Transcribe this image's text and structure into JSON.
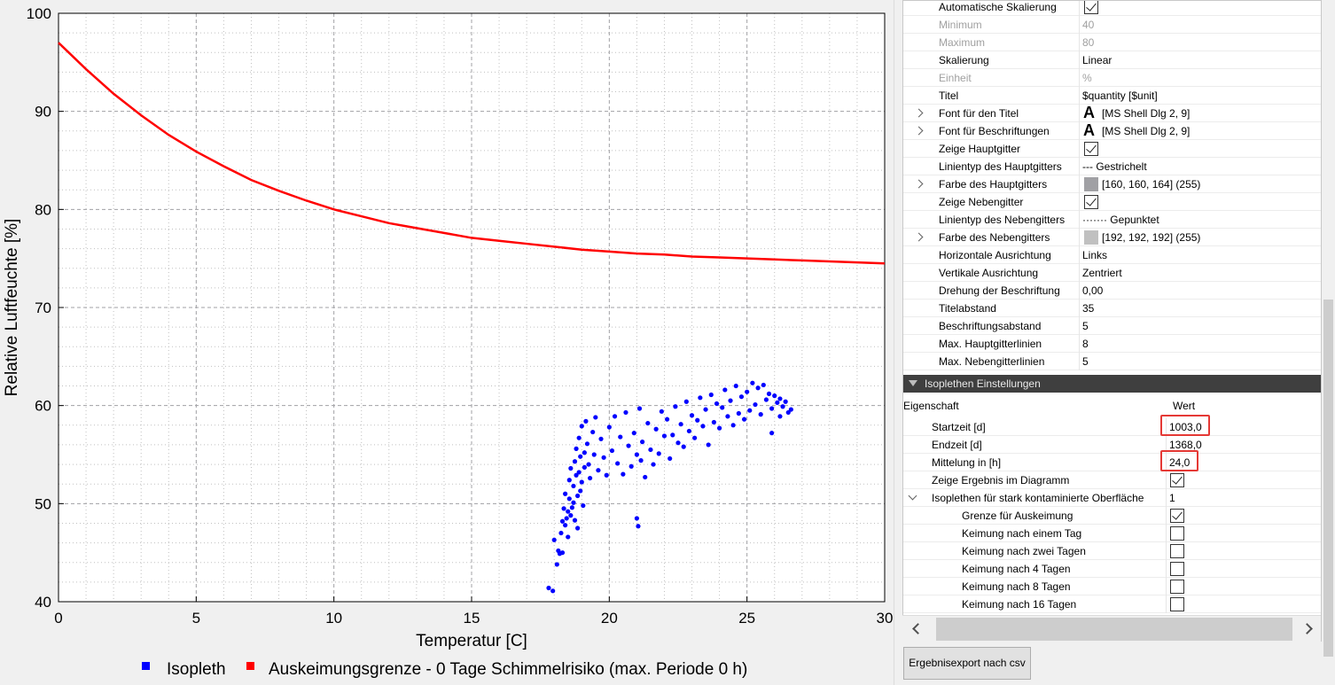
{
  "chart": {
    "xlabel": "Temperatur [C]",
    "ylabel": "Relative Luftfeuchte [%]",
    "legend": {
      "isopleth_label": "Isopleth",
      "limit_label": "Auskeimungsgrenze - 0 Tage Schimmelrisiko (max. Periode 0 h)"
    },
    "colors": {
      "isopleth": "#0000ff",
      "limit": "#ff0000",
      "grid": "#a0a0a4",
      "minor_grid": "#c0c0c0"
    }
  },
  "chart_data": {
    "type": "scatter",
    "xlim": [
      0,
      30
    ],
    "ylim": [
      40,
      100
    ],
    "x_ticks": [
      "0",
      "5",
      "10",
      "15",
      "20",
      "25",
      "30"
    ],
    "y_ticks": [
      "40",
      "50",
      "60",
      "70",
      "80",
      "90",
      "100"
    ],
    "grid": true,
    "legend_position": "bottom",
    "series": [
      {
        "name": "Auskeimungsgrenze - 0 Tage Schimmelrisiko (max. Periode 0 h)",
        "kind": "line",
        "color": "#ff0000",
        "x": [
          0,
          1,
          2,
          3,
          4,
          5,
          6,
          7,
          8,
          9,
          10,
          11,
          12,
          13,
          14,
          15,
          16,
          17,
          18,
          19,
          20,
          21,
          22,
          23,
          24,
          25,
          26,
          27,
          28,
          29,
          30
        ],
        "y": [
          97.0,
          94.3,
          91.8,
          89.6,
          87.6,
          85.9,
          84.4,
          83.0,
          81.9,
          80.9,
          80.0,
          79.3,
          78.6,
          78.1,
          77.6,
          77.1,
          76.8,
          76.5,
          76.2,
          75.9,
          75.7,
          75.5,
          75.4,
          75.2,
          75.1,
          75.0,
          74.9,
          74.8,
          74.7,
          74.6,
          74.5
        ]
      },
      {
        "name": "Isopleth",
        "kind": "scatter",
        "color": "#0000ff",
        "points": [
          [
            17.8,
            41.4
          ],
          [
            17.95,
            41.1
          ],
          [
            18.0,
            46.3
          ],
          [
            18.1,
            43.8
          ],
          [
            18.15,
            45.2
          ],
          [
            18.2,
            44.9
          ],
          [
            18.25,
            47.0
          ],
          [
            18.3,
            48.2
          ],
          [
            18.3,
            45.0
          ],
          [
            18.35,
            49.5
          ],
          [
            18.4,
            47.8
          ],
          [
            18.4,
            51.0
          ],
          [
            18.45,
            48.5
          ],
          [
            18.5,
            49.2
          ],
          [
            18.5,
            46.6
          ],
          [
            18.55,
            50.5
          ],
          [
            18.55,
            52.4
          ],
          [
            18.6,
            48.8
          ],
          [
            18.6,
            53.6
          ],
          [
            18.65,
            49.6
          ],
          [
            18.7,
            50.1
          ],
          [
            18.7,
            51.8
          ],
          [
            18.75,
            54.3
          ],
          [
            18.75,
            48.3
          ],
          [
            18.8,
            52.9
          ],
          [
            18.8,
            55.6
          ],
          [
            18.85,
            47.5
          ],
          [
            18.85,
            50.8
          ],
          [
            18.9,
            53.2
          ],
          [
            18.9,
            56.7
          ],
          [
            18.95,
            51.3
          ],
          [
            18.95,
            54.8
          ],
          [
            19.0,
            57.9
          ],
          [
            19.0,
            52.2
          ],
          [
            19.05,
            49.8
          ],
          [
            19.1,
            55.2
          ],
          [
            19.1,
            53.7
          ],
          [
            19.15,
            58.4
          ],
          [
            19.2,
            56.1
          ],
          [
            19.25,
            54.0
          ],
          [
            19.3,
            52.6
          ],
          [
            19.4,
            57.3
          ],
          [
            19.45,
            55.0
          ],
          [
            19.5,
            58.8
          ],
          [
            19.6,
            53.4
          ],
          [
            19.7,
            56.6
          ],
          [
            19.8,
            54.7
          ],
          [
            19.9,
            52.9
          ],
          [
            20.0,
            57.8
          ],
          [
            20.1,
            55.4
          ],
          [
            20.2,
            58.9
          ],
          [
            20.3,
            54.1
          ],
          [
            20.4,
            56.8
          ],
          [
            20.5,
            53.0
          ],
          [
            20.6,
            59.3
          ],
          [
            20.7,
            55.9
          ],
          [
            20.8,
            53.8
          ],
          [
            20.9,
            57.2
          ],
          [
            21.0,
            55.0
          ],
          [
            21.1,
            59.7
          ],
          [
            21.0,
            48.5
          ],
          [
            21.05,
            47.7
          ],
          [
            21.15,
            54.4
          ],
          [
            21.2,
            56.3
          ],
          [
            21.3,
            52.7
          ],
          [
            21.4,
            58.2
          ],
          [
            21.5,
            55.5
          ],
          [
            21.6,
            54.0
          ],
          [
            21.7,
            57.6
          ],
          [
            21.8,
            55.1
          ],
          [
            21.9,
            59.4
          ],
          [
            22.0,
            56.9
          ],
          [
            22.1,
            58.6
          ],
          [
            22.2,
            54.6
          ],
          [
            22.3,
            57.0
          ],
          [
            22.4,
            59.9
          ],
          [
            22.5,
            56.2
          ],
          [
            22.6,
            58.1
          ],
          [
            22.7,
            55.8
          ],
          [
            22.8,
            60.4
          ],
          [
            22.9,
            57.4
          ],
          [
            23.0,
            59.0
          ],
          [
            23.1,
            56.7
          ],
          [
            23.2,
            58.5
          ],
          [
            23.3,
            60.8
          ],
          [
            23.4,
            57.9
          ],
          [
            23.5,
            59.6
          ],
          [
            23.6,
            56.0
          ],
          [
            23.7,
            61.1
          ],
          [
            23.8,
            58.3
          ],
          [
            23.9,
            60.2
          ],
          [
            24.0,
            57.7
          ],
          [
            24.1,
            59.8
          ],
          [
            24.2,
            61.6
          ],
          [
            24.3,
            58.9
          ],
          [
            24.4,
            60.5
          ],
          [
            24.5,
            58.0
          ],
          [
            24.6,
            62.0
          ],
          [
            24.7,
            59.2
          ],
          [
            24.8,
            60.9
          ],
          [
            24.9,
            58.6
          ],
          [
            25.0,
            61.4
          ],
          [
            25.1,
            59.5
          ],
          [
            25.2,
            62.3
          ],
          [
            25.3,
            60.1
          ],
          [
            25.4,
            61.8
          ],
          [
            25.5,
            59.1
          ],
          [
            25.6,
            62.1
          ],
          [
            25.7,
            60.6
          ],
          [
            25.8,
            61.2
          ],
          [
            25.9,
            59.7
          ],
          [
            26.0,
            61.0
          ],
          [
            26.1,
            60.3
          ],
          [
            26.2,
            60.7
          ],
          [
            26.3,
            59.9
          ],
          [
            26.4,
            60.4
          ],
          [
            26.5,
            59.3
          ],
          [
            26.6,
            59.6
          ],
          [
            25.9,
            57.2
          ],
          [
            26.2,
            58.9
          ]
        ]
      }
    ]
  },
  "properties": {
    "rows": [
      {
        "name": "Automatische Skalierung",
        "value": "",
        "check": true
      },
      {
        "name": "Minimum",
        "value": "40",
        "disabled": true
      },
      {
        "name": "Maximum",
        "value": "80",
        "disabled": true
      },
      {
        "name": "Skalierung",
        "value": "Linear"
      },
      {
        "name": "Einheit",
        "value": "%",
        "disabled": true
      },
      {
        "name": "Titel",
        "value": "$quantity [$unit]"
      },
      {
        "name": "Font für den Titel",
        "value": "[MS Shell Dlg 2, 9]",
        "font": true,
        "expand": true
      },
      {
        "name": "Font für Beschriftungen",
        "value": "[MS Shell Dlg 2, 9]",
        "font": true,
        "expand": true
      },
      {
        "name": "Zeige Hauptgitter",
        "value": "",
        "check": true
      },
      {
        "name": "Linientyp des Hauptgitters",
        "value": "--- Gestrichelt"
      },
      {
        "name": "Farbe des Hauptgitters",
        "value": "[160, 160, 164] (255)",
        "swatch": "#a0a0a4",
        "expand": true
      },
      {
        "name": "Zeige Nebengitter",
        "value": "",
        "check": true
      },
      {
        "name": "Linientyp des Nebengitters",
        "value": "······· Gepunktet"
      },
      {
        "name": "Farbe des Nebengitters",
        "value": "[192, 192, 192] (255)",
        "swatch": "#c0c0c0",
        "expand": true
      },
      {
        "name": "Horizontale Ausrichtung",
        "value": "Links"
      },
      {
        "name": "Vertikale Ausrichtung",
        "value": "Zentriert"
      },
      {
        "name": "Drehung der Beschriftung",
        "value": "0,00"
      },
      {
        "name": "Titelabstand",
        "value": "35"
      },
      {
        "name": "Beschriftungsabstand",
        "value": "5"
      },
      {
        "name": "Max. Hauptgitterlinien",
        "value": "8"
      },
      {
        "name": "Max. Nebengitterlinien",
        "value": "5"
      }
    ],
    "section_title": "Isoplethen Einstellungen",
    "header_name": "Eigenschaft",
    "header_value": "Wert",
    "iso_rows": [
      {
        "name": "Startzeit [d]",
        "value": "1003,0",
        "highlight": true
      },
      {
        "name": "Endzeit [d]",
        "value": "1368,0"
      },
      {
        "name": "Mittelung in [h]",
        "value": "24,0",
        "highlight": true
      },
      {
        "name": "Zeige Ergebnis im Diagramm",
        "value": "",
        "check": true
      }
    ],
    "group_name": "Isoplethen für stark kontaminierte Oberfläche",
    "group_value": "1",
    "sub_rows": [
      {
        "name": "Grenze für Auskeimung",
        "check": true
      },
      {
        "name": "Keimung nach einem Tag",
        "check": false
      },
      {
        "name": "Keimung nach zwei Tagen",
        "check": false
      },
      {
        "name": "Keimung nach 4 Tagen",
        "check": false
      },
      {
        "name": "Keimung nach 8 Tagen",
        "check": false
      },
      {
        "name": "Keimung nach 16 Tagen",
        "check": false
      }
    ]
  },
  "export_button": "Ergebnisexport nach csv"
}
